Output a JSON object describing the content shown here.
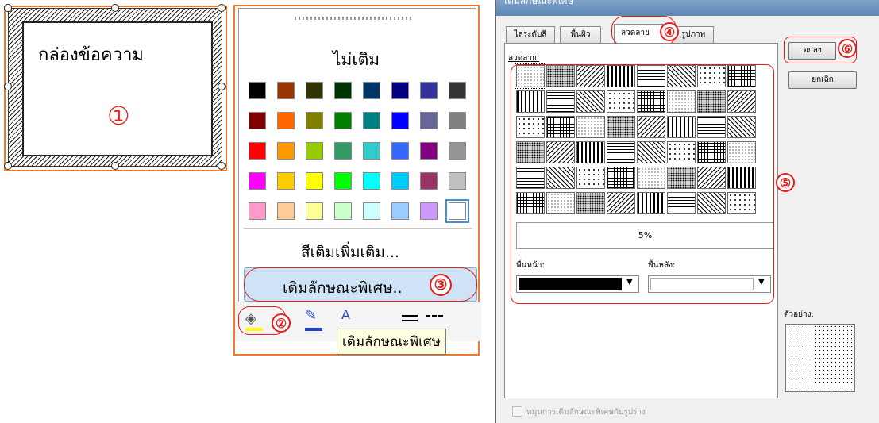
{
  "textbox": {
    "text": "กล่องข้อความ",
    "marker": "①"
  },
  "color_menu": {
    "no_fill_label": "ไม่เติม",
    "more_colors_label": "สีเติมเพิ่มเติม...",
    "fill_effects_label": "เติมลักษณะพิเศษ..",
    "marker_fill_effects": "③",
    "marker_fill_button": "②",
    "tooltip": "เติมลักษณะพิเศษ",
    "swatch_rows": [
      [
        "#000000",
        "#993300",
        "#333300",
        "#003300",
        "#003366",
        "#000080",
        "#333399",
        "#333333"
      ],
      [
        "#800000",
        "#ff6600",
        "#808000",
        "#008000",
        "#008080",
        "#0000ff",
        "#666699",
        "#808080"
      ],
      [
        "#ff0000",
        "#ff9900",
        "#99cc00",
        "#339966",
        "#33cccc",
        "#3366ff",
        "#800080",
        "#969696"
      ],
      [
        "#ff00ff",
        "#ffcc00",
        "#ffff00",
        "#00ff00",
        "#00ffff",
        "#00ccff",
        "#993366",
        "#c0c0c0"
      ],
      [
        "#ff99cc",
        "#ffcc99",
        "#ffff99",
        "#ccffcc",
        "#ccffff",
        "#99ccff",
        "#cc99ff",
        "#ffffff"
      ]
    ]
  },
  "dialog": {
    "title": "เติมลักษณะพิเศษ",
    "tabs": [
      "ไล่ระดับสี",
      "พื้นผิว",
      "ลวดลาย",
      "รูปภาพ"
    ],
    "active_tab_index": 2,
    "marker_tab": "④",
    "pattern_label": "ลวดลาย:",
    "selected_pattern_name": "5%",
    "foreground_label": "พื้นหน้า:",
    "background_label": "พื้นหลัง:",
    "foreground_color": "#000000",
    "background_color": "#ffffff",
    "ok_label": "ตกลง",
    "cancel_label": "ยกเลิก",
    "marker_ok": "⑥",
    "marker_patterns": "⑤",
    "sample_label": "ตัวอย่าง:",
    "rotate_checkbox_label": "หมุนการเติมลักษณะพิเศษกับรูปร่าง"
  },
  "colors": {
    "annotation_red": "#e51d1d",
    "frame_orange": "#f07a2a",
    "highlight_blue": "#cfe3f7"
  }
}
